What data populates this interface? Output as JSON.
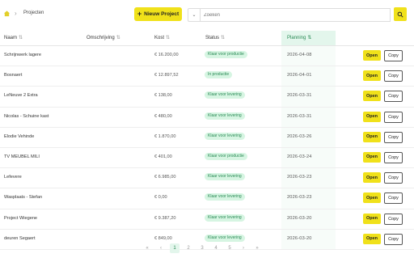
{
  "breadcrumb": {
    "home_icon": "home-icon",
    "separator": "›",
    "current": "Projecten"
  },
  "toolbar": {
    "new_label": "Nieuw Project",
    "search_placeholder": "Zoeken",
    "filter_icon": "chevron-down-icon",
    "search_icon": "search-icon"
  },
  "columns": {
    "naam": "Naam",
    "omschrijving": "Omschrijving",
    "kost": "Kost",
    "status": "Status",
    "planning": "Planning",
    "sort_glyph": "⇅"
  },
  "rows": [
    {
      "naam": "Schrijnwerk lagere",
      "kost": "€ 16.200,00",
      "status": "Klaar voor productie",
      "planning": "2026-04-08"
    },
    {
      "naam": "Bosnaert",
      "kost": "€ 12.897,52",
      "status": "In productie",
      "planning": "2026-04-01"
    },
    {
      "naam": "LeNeuve 2 Extra",
      "kost": "€ 138,00",
      "status": "Klaar voor levering",
      "planning": "2026-03-31"
    },
    {
      "naam": "Nicolas - Schuine kast",
      "kost": "€ 480,00",
      "status": "Klaar voor levering",
      "planning": "2026-03-31"
    },
    {
      "naam": "Elodie Vehinde",
      "kost": "€ 1.870,00",
      "status": "Klaar voor levering",
      "planning": "2026-03-26"
    },
    {
      "naam": "TV MEUBEL MILI",
      "kost": "€ 401,00",
      "status": "Klaar voor productie",
      "planning": "2026-03-24"
    },
    {
      "naam": "Lefevere",
      "kost": "€ 6.985,00",
      "status": "Klaar voor levering",
      "planning": "2026-03-23"
    },
    {
      "naam": "Wasplaats - Stefan",
      "kost": "€ 0,00",
      "status": "Klaar voor levering",
      "planning": "2026-03-23"
    },
    {
      "naam": "Project Wiegene",
      "kost": "€ 9.387,20",
      "status": "Klaar voor levering",
      "planning": "2026-03-20"
    },
    {
      "naam": "deuren Segaert",
      "kost": "€ 849,00",
      "status": "Klaar voor levering",
      "planning": "2026-03-20"
    }
  ],
  "actions": {
    "open": "Open",
    "copy": "Copy"
  },
  "pagination": {
    "first": "«",
    "prev": "‹",
    "pages": [
      "1",
      "2",
      "3",
      "4",
      "5"
    ],
    "next": "›",
    "last": "»",
    "current": "1"
  },
  "colors": {
    "accent": "#f0e11a",
    "status_bg": "#d6f5e2",
    "status_text": "#2a8a55",
    "planning_header_bg": "#e3f6ec"
  }
}
